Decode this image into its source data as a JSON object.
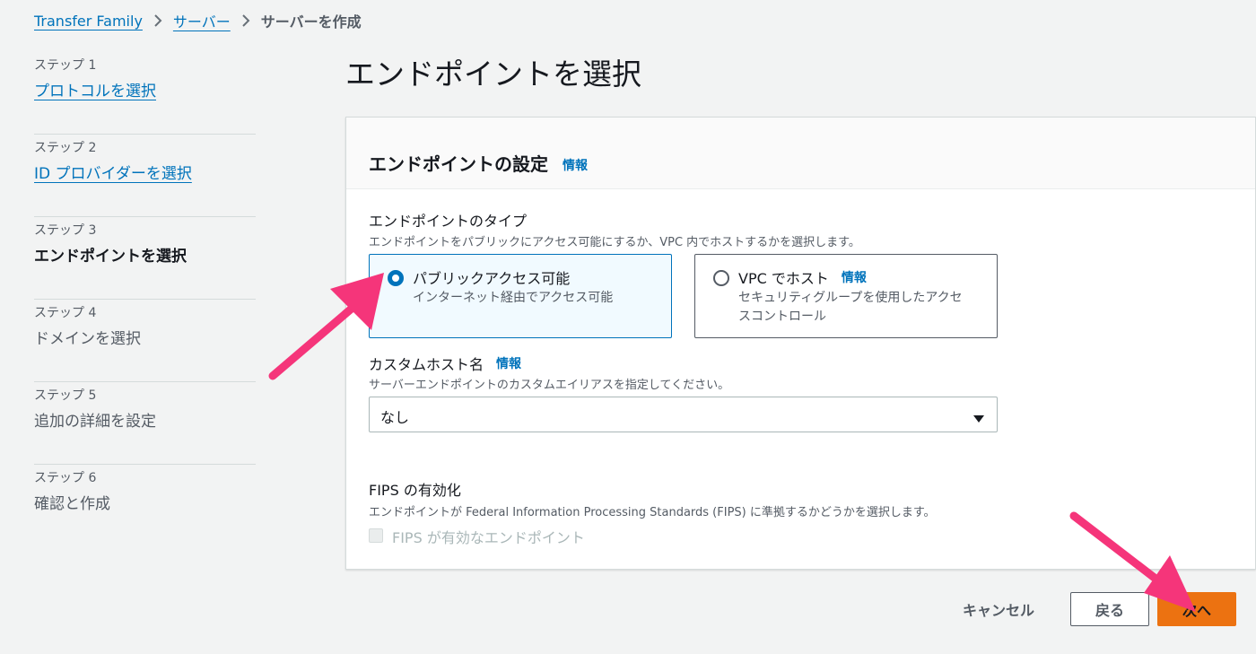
{
  "breadcrumb": {
    "items": [
      "Transfer Family",
      "サーバー"
    ],
    "current": "サーバーを作成"
  },
  "steps": [
    {
      "number": "ステップ 1",
      "title": "プロトコルを選択",
      "state": "link"
    },
    {
      "number": "ステップ 2",
      "title": "ID プロバイダーを選択",
      "state": "link"
    },
    {
      "number": "ステップ 3",
      "title": "エンドポイントを選択",
      "state": "current"
    },
    {
      "number": "ステップ 4",
      "title": "ドメインを選択",
      "state": "plain"
    },
    {
      "number": "ステップ 5",
      "title": "追加の詳細を設定",
      "state": "plain"
    },
    {
      "number": "ステップ 6",
      "title": "確認と作成",
      "state": "plain"
    }
  ],
  "page_title": "エンドポイントを選択",
  "panel": {
    "title": "エンドポイントの設定",
    "info": "情報",
    "endpoint_type": {
      "label": "エンドポイントのタイプ",
      "description": "エンドポイントをパブリックにアクセス可能にするか、VPC 内でホストするかを選択します。",
      "options": [
        {
          "title": "パブリックアクセス可能",
          "description": "インターネット経由でアクセス可能",
          "selected": true
        },
        {
          "title": "VPC でホスト",
          "info": "情報",
          "description_line1": "セキュリティグループを使用したアクセ",
          "description_line2": "スコントロール",
          "selected": false
        }
      ]
    },
    "custom_hostname": {
      "label": "カスタムホスト名",
      "info": "情報",
      "description": "サーバーエンドポイントのカスタムエイリアスを指定してください。",
      "value": "なし"
    },
    "fips": {
      "label": "FIPS の有効化",
      "description": "エンドポイントが Federal Information Processing Standards (FIPS) に準拠するかどうかを選択します。",
      "checkbox_label": "FIPS が有効なエンドポイント",
      "checked": false,
      "disabled": true
    }
  },
  "actions": {
    "cancel": "キャンセル",
    "back": "戻る",
    "next": "次へ"
  },
  "colors": {
    "link": "#0073bb",
    "primary_button": "#ec7211",
    "annotation_arrow": "#f5357a",
    "selected_tile_bg": "#f1faff"
  }
}
